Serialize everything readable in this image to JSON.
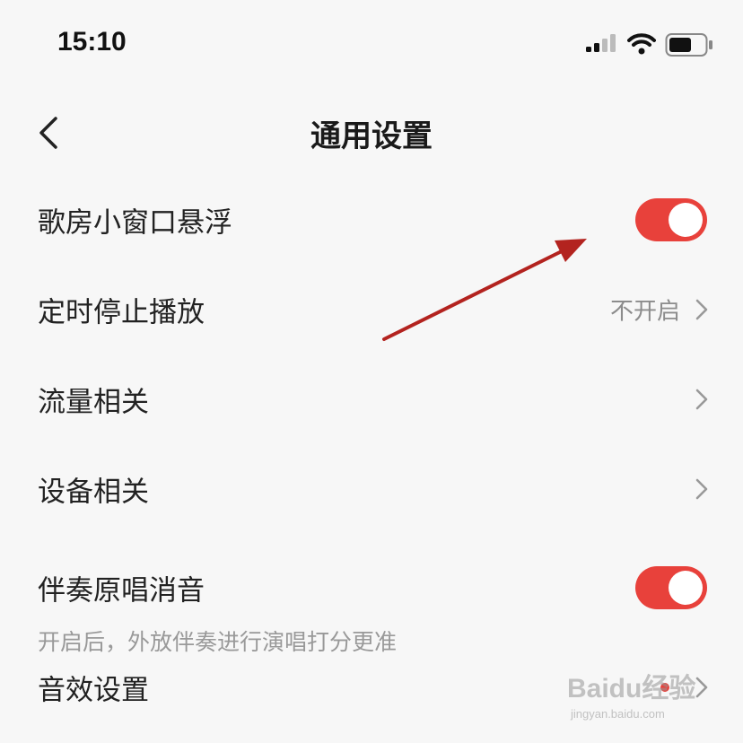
{
  "status_bar": {
    "time": "15:10"
  },
  "header": {
    "title": "通用设置",
    "back_icon": "chevron-left-icon"
  },
  "settings": {
    "floating_window": {
      "label": "歌房小窗口悬浮",
      "enabled": true
    },
    "sleep_timer": {
      "label": "定时停止播放",
      "value": "不开启"
    },
    "data_usage": {
      "label": "流量相关"
    },
    "devices": {
      "label": "设备相关"
    },
    "vocal_removal": {
      "label": "伴奏原唱消音",
      "enabled": true,
      "description": "开启后，外放伴奏进行演唱打分更准"
    },
    "sound_effects": {
      "label": "音效设置",
      "has_badge": true
    }
  },
  "colors": {
    "accent": "#e8413b",
    "annotation_arrow": "#b3231f",
    "background": "#f7f7f7"
  },
  "watermark": {
    "main": "Baidu经验",
    "sub": "jingyan.baidu.com"
  }
}
